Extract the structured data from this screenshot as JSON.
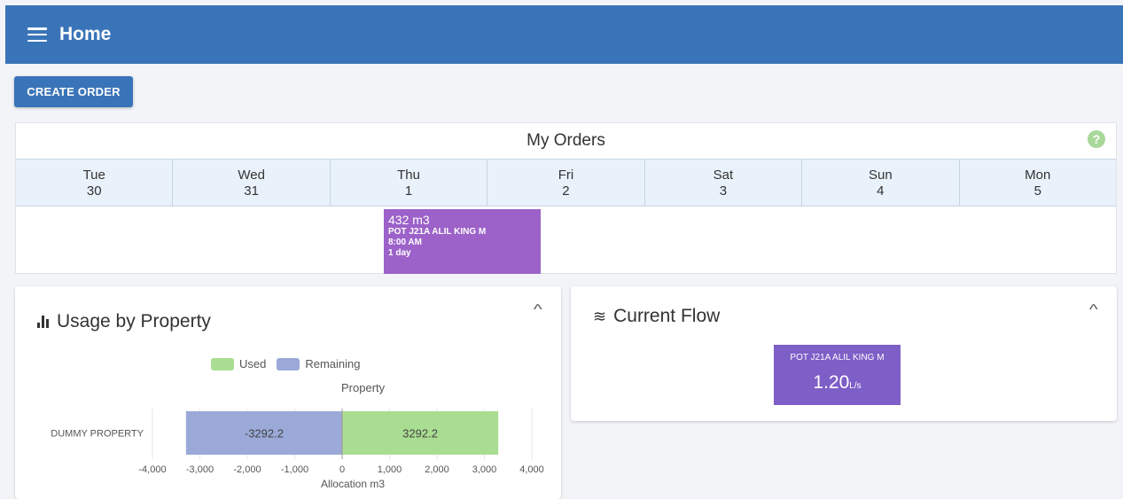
{
  "header": {
    "title": "Home",
    "menu_icon": "hamburger-menu-icon"
  },
  "toolbar": {
    "create_order_label": "CREATE ORDER"
  },
  "orders": {
    "title": "My Orders",
    "help_icon": "help-icon",
    "help_glyph": "?",
    "days": [
      {
        "name": "Tue",
        "date": "30"
      },
      {
        "name": "Wed",
        "date": "31"
      },
      {
        "name": "Thu",
        "date": "1"
      },
      {
        "name": "Fri",
        "date": "2"
      },
      {
        "name": "Sat",
        "date": "3"
      },
      {
        "name": "Sun",
        "date": "4"
      },
      {
        "name": "Mon",
        "date": "5"
      }
    ],
    "event": {
      "quantity": "432 m3",
      "name": "POT J21A ALIL KING M",
      "time": "8:00 AM",
      "duration": "1 day",
      "color": "#9c62c9"
    }
  },
  "usage": {
    "title": "Usage by Property",
    "icon": "bar-chart-icon",
    "collapse_glyph": "^"
  },
  "chart_data": {
    "type": "bar",
    "orientation": "horizontal",
    "stacked": true,
    "categories": [
      "DUMMY PROPERTY"
    ],
    "series": [
      {
        "name": "Used",
        "values": [
          3292.2
        ],
        "color": "#a9dd91"
      },
      {
        "name": "Remaining",
        "values": [
          -3292.2
        ],
        "color": "#9aa9d8"
      }
    ],
    "data_labels": [
      "-3292.2",
      "3292.2"
    ],
    "title": "Property",
    "xlabel": "Allocation m3",
    "xlim": [
      -4000,
      4000
    ],
    "xticks": [
      -4000,
      -3000,
      -2000,
      -1000,
      0,
      1000,
      2000,
      3000,
      4000
    ],
    "xtick_labels": [
      "-4,000",
      "-3,000",
      "-2,000",
      "-1,000",
      "0",
      "1,000",
      "2,000",
      "3,000",
      "4,000"
    ],
    "legend": "top-center",
    "grid": true
  },
  "flow": {
    "title": "Current Flow",
    "icon": "waves-icon",
    "wave_glyph": "≋",
    "collapse_glyph": "^",
    "tile": {
      "name": "POT J21A ALIL KING M",
      "value": "1.20",
      "unit": "L/s",
      "color": "#7e5ec7"
    }
  }
}
